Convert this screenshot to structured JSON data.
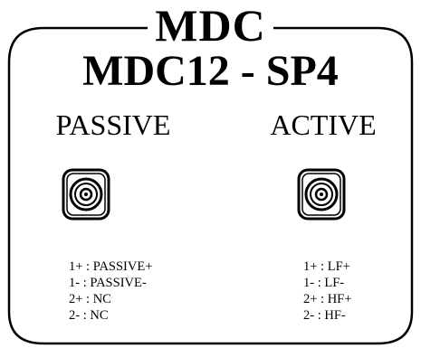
{
  "brand": "MDC",
  "model": "MDC12 - SP4",
  "panels": [
    {
      "title": "PASSIVE",
      "connector_icon": "speakon-connector-icon",
      "pins": [
        "1+ : PASSIVE+",
        "1- : PASSIVE-",
        "2+ : NC",
        "2- : NC"
      ]
    },
    {
      "title": "ACTIVE",
      "connector_icon": "speakon-connector-icon",
      "pins": [
        "1+ : LF+",
        "1- : LF-",
        "2+ : HF+",
        "2- : HF-"
      ]
    }
  ],
  "colors": {
    "ink": "#000000",
    "background": "#ffffff"
  }
}
